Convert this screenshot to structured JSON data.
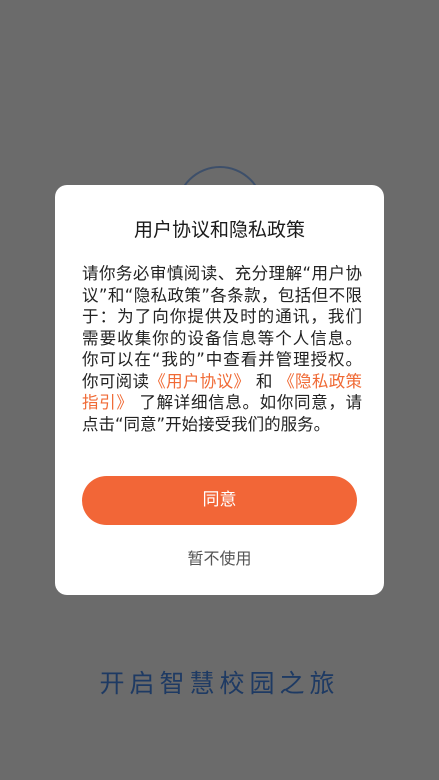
{
  "splash": {
    "slogan": "开启智慧校园之旅"
  },
  "dialog": {
    "title": "用户协议和隐私政策",
    "body_part1": "请你务必审慎阅读、充分理解“用户协议”和“隐私政策”各条款，包括但不限于：为了向你提供及时的通讯，我们需要收集你的设备信息等个人信息。你可以在“我的”中查看并管理授权。你可阅读",
    "user_agreement_link": "《用户协议》",
    "and_text": "和",
    "privacy_link": "《隐私政策指引》",
    "body_part2": "了解详细信息。如你同意，请点击“同意”开始接受我们的服务。",
    "agree_label": "同意",
    "decline_label": "暂不使用"
  },
  "colors": {
    "accent": "#f26637",
    "overlay": "#6b6b6b",
    "slogan": "#1e3a63"
  }
}
